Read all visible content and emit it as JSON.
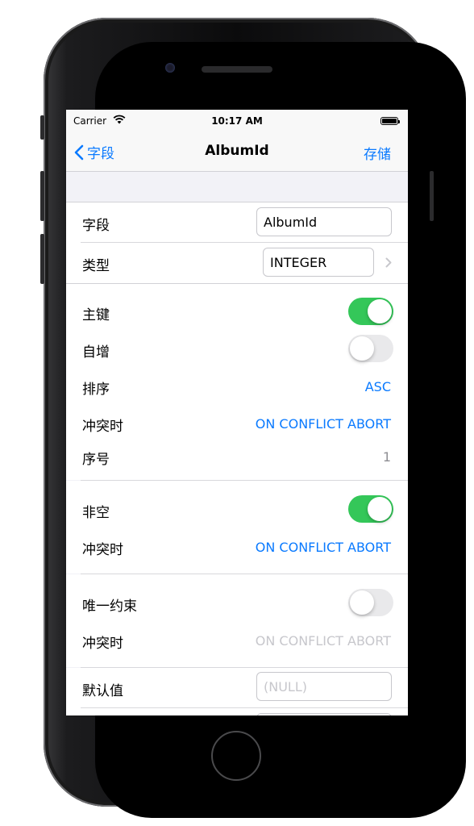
{
  "status_bar": {
    "carrier": "Carrier",
    "time": "10:17 AM"
  },
  "nav": {
    "back_label": "字段",
    "title": "AlbumId",
    "save_label": "存储"
  },
  "field_section": {
    "name_label": "字段",
    "name_value": "AlbumId",
    "type_label": "类型",
    "type_value": "INTEGER"
  },
  "primary_key_section": {
    "primary_key_label": "主键",
    "primary_key_on": true,
    "autoincrement_label": "自增",
    "autoincrement_on": false,
    "order_label": "排序",
    "order_value": "ASC",
    "conflict_label": "冲突时",
    "conflict_value": "ON CONFLICT ABORT",
    "seq_label": "序号",
    "seq_value": "1"
  },
  "not_null_section": {
    "not_null_label": "非空",
    "not_null_on": true,
    "conflict_label": "冲突时",
    "conflict_value": "ON CONFLICT ABORT"
  },
  "unique_section": {
    "unique_label": "唯一约束",
    "unique_on": false,
    "conflict_label": "冲突时",
    "conflict_value": "ON CONFLICT ABORT"
  },
  "default_section": {
    "default_label": "默认值",
    "default_placeholder": "(NULL)"
  },
  "colors": {
    "accent": "#0a7aff",
    "toggle_on": "#34c759",
    "disabled_text": "#c7c7cc"
  }
}
